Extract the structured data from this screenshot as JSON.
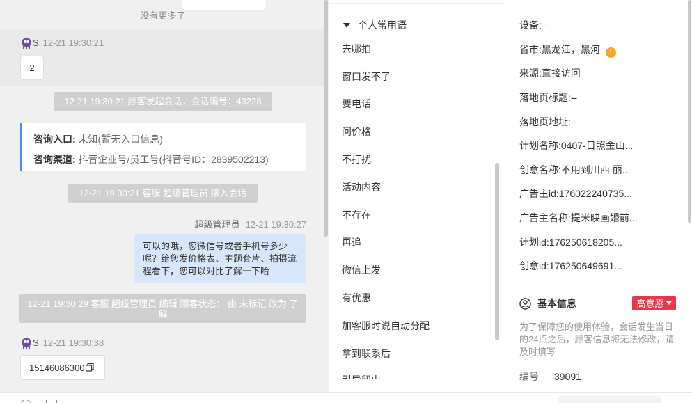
{
  "chat": {
    "no_more": "没有更多了",
    "msg1": {
      "name": "S",
      "time": "12-21 19:30:21",
      "text": "2"
    },
    "sys1": "12-21 19:30:21 顾客发起会话，会话编号：43228",
    "consult": {
      "entry_label": "咨询入口:",
      "entry_value": "未知(暂无入口信息)",
      "channel_label": "咨询渠道:",
      "channel_value": "抖音企业号/员工号(抖音号ID：2839502213)"
    },
    "sys2": "12-21 19:30:21 客服 超级管理员 接入会话",
    "agent_msg": {
      "name": "超级管理员",
      "time": "12-21 19:30:27",
      "text": "可以的哦，您微信号或者手机号多少呢？给您发价格表、主题套片、拍摄流程看下，您可以对比了解一下哈"
    },
    "sys3": "12-21 19:30:29 客服 超级管理员 编辑 顾客状态： 由 未标记 改为 了解",
    "msg2": {
      "name": "S",
      "time": "12-21 19:30:38",
      "text": "15146086300"
    }
  },
  "phrases": {
    "group_label": "个人常用语",
    "items": [
      "去哪拍",
      "窗口发不了",
      "要电话",
      "问价格",
      "不打扰",
      "活动内容",
      "不存在",
      "再追",
      "微信上发",
      "有优惠",
      "加客服时说自动分配",
      "拿到联系后",
      "引导留电"
    ]
  },
  "info": {
    "rows": [
      {
        "label": "设备:",
        "value": "--"
      },
      {
        "label": "省市:",
        "value": "黑龙江，黑河"
      },
      {
        "label": "来源:",
        "value": "直接访问"
      },
      {
        "label": "落地页标题:",
        "value": "--"
      },
      {
        "label": "落地页地址:",
        "value": "--"
      },
      {
        "label": "计划名称:",
        "value": "0407-日照金山..."
      },
      {
        "label": "创意名称:",
        "value": "不用到川西 丽..."
      },
      {
        "label": "广告主id:",
        "value": "176022240735..."
      },
      {
        "label": "广告主名称:",
        "value": "提米映画婚前..."
      },
      {
        "label": "计划id:",
        "value": "176250618205..."
      },
      {
        "label": "创意id:",
        "value": "176250649691..."
      }
    ],
    "warn_glyph": "!",
    "section_title": "基本信息",
    "intent_label": "高意愿",
    "hint": "为了保障您的使用体验，会话发生当日的24点之后，顾客信息将无法修改，请及时填写",
    "number_label": "编号",
    "number_value": "39091"
  },
  "colors": {
    "accent": "#4c8df6",
    "agent_bubble": "#d8e6fb",
    "intent": "#e8384f",
    "warn": "#f5a623"
  }
}
